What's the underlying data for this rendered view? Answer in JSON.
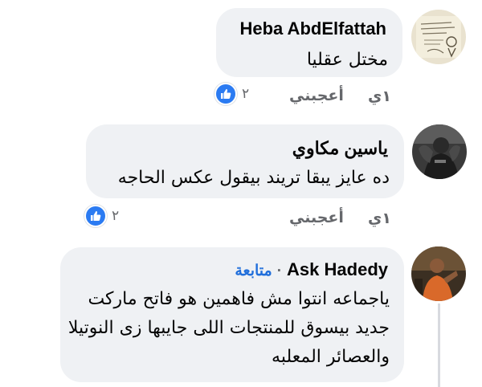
{
  "comments": [
    {
      "author": "Heba AbdElfattah",
      "text": "مختل عقليا",
      "time": "١ي",
      "like_label": "أعجبني",
      "reaction_count": "٢"
    },
    {
      "author": "ياسين مكاوي",
      "text": "ده عايز يبقا تريند بيقول عكس الحاجه",
      "time": "١ي",
      "like_label": "أعجبني",
      "reaction_count": "٢"
    },
    {
      "author": "Ask Hadedy",
      "follow_label": "متابعة",
      "text_lines": [
        "ياجماعه انتوا مش فاهمين هو فاتح ماركت",
        "جديد بيسوق للمنتجات اللى جايبها زى النوتيلا",
        "والعصائر المعلبه"
      ]
    }
  ],
  "colors": {
    "bubble": "#eff1f4",
    "like_blue": "#2b7bf2",
    "follow_blue": "#216fdb",
    "meta_gray": "#65676b"
  }
}
